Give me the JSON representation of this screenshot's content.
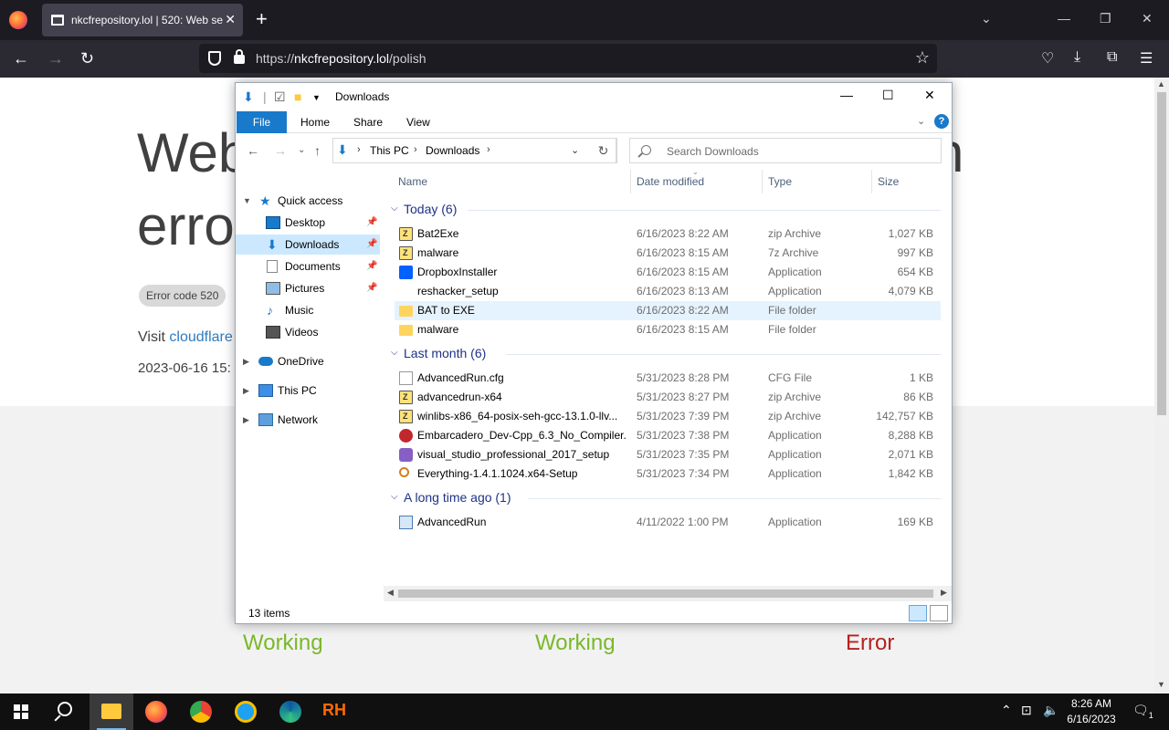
{
  "browser": {
    "tab_title": "nkcfrepository.lol | 520: Web se",
    "url_domain": "nkcfrepository.lol",
    "url_prefix": "https://",
    "url_path": "/polish"
  },
  "webpage": {
    "heading_line1": "Web",
    "heading_line2": "erro",
    "heading_right": "n",
    "error_badge": "Error code 520",
    "visit_text": "Visit",
    "visit_link": "cloudflare",
    "timestamp": "2023-06-16 15:",
    "status_1": "Working",
    "status_2": "Working",
    "status_3": "Error",
    "colors": {
      "working": "#7ab829",
      "error": "#b72121",
      "link": "#2f7bbf"
    }
  },
  "explorer": {
    "title": "Downloads",
    "ribbon_tabs": [
      "File",
      "Home",
      "Share",
      "View"
    ],
    "help_label": "?",
    "breadcrumb": [
      "This PC",
      "Downloads"
    ],
    "search_placeholder": "Search Downloads",
    "nav": {
      "quick_access": "Quick access",
      "desktop": "Desktop",
      "downloads": "Downloads",
      "documents": "Documents",
      "pictures": "Pictures",
      "music": "Music",
      "videos": "Videos",
      "onedrive": "OneDrive",
      "this_pc": "This PC",
      "network": "Network"
    },
    "columns": {
      "name": "Name",
      "date": "Date modified",
      "type": "Type",
      "size": "Size"
    },
    "groups": [
      {
        "label": "Today (6)"
      },
      {
        "label": "Last month (6)"
      },
      {
        "label": "A long time ago (1)"
      }
    ],
    "files": [
      {
        "name": "Bat2Exe",
        "date": "6/16/2023 8:22 AM",
        "type": "zip Archive",
        "size": "1,027 KB",
        "icon": "zip-icon"
      },
      {
        "name": "malware",
        "date": "6/16/2023 8:15 AM",
        "type": "7z Archive",
        "size": "997 KB",
        "icon": "zip-icon"
      },
      {
        "name": "DropboxInstaller",
        "date": "6/16/2023 8:15 AM",
        "type": "Application",
        "size": "654 KB",
        "icon": "dropbox-icon"
      },
      {
        "name": "reshacker_setup",
        "date": "6/16/2023 8:13 AM",
        "type": "Application",
        "size": "4,079 KB",
        "icon": "reshacker-icon"
      },
      {
        "name": "BAT to EXE",
        "date": "6/16/2023 8:22 AM",
        "type": "File folder",
        "size": "",
        "icon": "folder-icon"
      },
      {
        "name": "malware",
        "date": "6/16/2023 8:15 AM",
        "type": "File folder",
        "size": "",
        "icon": "folder-icon"
      },
      {
        "name": "AdvancedRun.cfg",
        "date": "5/31/2023 8:28 PM",
        "type": "CFG File",
        "size": "1 KB",
        "icon": "file-icon"
      },
      {
        "name": "advancedrun-x64",
        "date": "5/31/2023 8:27 PM",
        "type": "zip Archive",
        "size": "86 KB",
        "icon": "zip-icon"
      },
      {
        "name": "winlibs-x86_64-posix-seh-gcc-13.1.0-llv...",
        "date": "5/31/2023 7:39 PM",
        "type": "zip Archive",
        "size": "142,757 KB",
        "icon": "zip-icon"
      },
      {
        "name": "Embarcadero_Dev-Cpp_6.3_No_Compiler...",
        "date": "5/31/2023 7:38 PM",
        "type": "Application",
        "size": "8,288 KB",
        "icon": "devcpp-icon"
      },
      {
        "name": "visual_studio_professional_2017_setup",
        "date": "5/31/2023 7:35 PM",
        "type": "Application",
        "size": "2,071 KB",
        "icon": "visual-studio-icon"
      },
      {
        "name": "Everything-1.4.1.1024.x64-Setup",
        "date": "5/31/2023 7:34 PM",
        "type": "Application",
        "size": "1,842 KB",
        "icon": "everything-search-icon"
      },
      {
        "name": "AdvancedRun",
        "date": "4/11/2022 1:00 PM",
        "type": "Application",
        "size": "169 KB",
        "icon": "advancedrun-icon"
      }
    ],
    "status_count": "13 items"
  },
  "taskbar": {
    "time": "8:26 AM",
    "date": "6/16/2023",
    "notification_count": "1"
  }
}
